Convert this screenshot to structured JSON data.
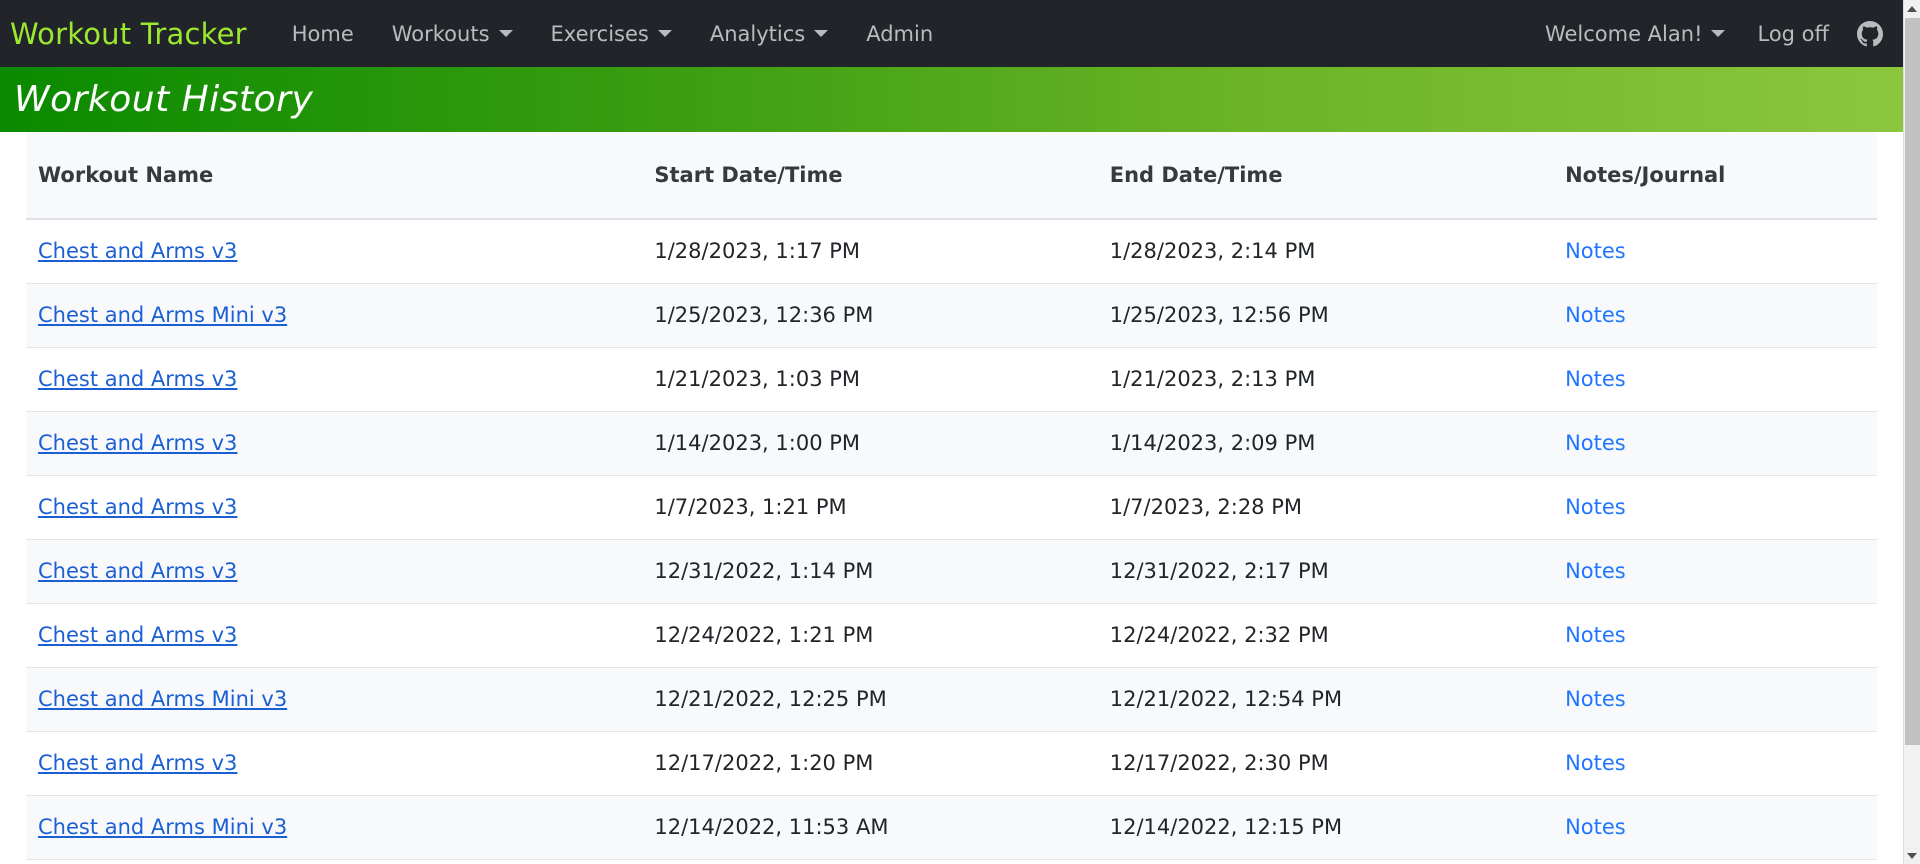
{
  "navbar": {
    "brand": "Workout Tracker",
    "links": [
      {
        "label": "Home",
        "has_caret": false
      },
      {
        "label": "Workouts",
        "has_caret": true
      },
      {
        "label": "Exercises",
        "has_caret": true
      },
      {
        "label": "Analytics",
        "has_caret": true
      },
      {
        "label": "Admin",
        "has_caret": false
      }
    ],
    "welcome_label": "Welcome Alan!",
    "logoff_label": "Log off",
    "github_icon": "github-icon",
    "background_color": "#212529",
    "brand_color": "#9CE82E",
    "link_color": "#B9BCBF"
  },
  "page_header": {
    "title": "Workout History",
    "gradient_from": "#0a8a00",
    "gradient_to": "#8cc63f"
  },
  "table": {
    "columns": [
      "Workout Name",
      "Start Date/Time",
      "End Date/Time",
      "Notes/Journal"
    ],
    "notes_label": "Notes",
    "link_color": "#1a5fd6",
    "notes_link_color": "#2176ff",
    "rows": [
      {
        "name": "Chest and Arms v3",
        "start": "1/28/2023, 1:17 PM",
        "end": "1/28/2023, 2:14 PM",
        "notes": "Notes"
      },
      {
        "name": "Chest and Arms Mini v3",
        "start": "1/25/2023, 12:36 PM",
        "end": "1/25/2023, 12:56 PM",
        "notes": "Notes"
      },
      {
        "name": "Chest and Arms v3",
        "start": "1/21/2023, 1:03 PM",
        "end": "1/21/2023, 2:13 PM",
        "notes": "Notes"
      },
      {
        "name": "Chest and Arms v3",
        "start": "1/14/2023, 1:00 PM",
        "end": "1/14/2023, 2:09 PM",
        "notes": "Notes"
      },
      {
        "name": "Chest and Arms v3",
        "start": "1/7/2023, 1:21 PM",
        "end": "1/7/2023, 2:28 PM",
        "notes": "Notes"
      },
      {
        "name": "Chest and Arms v3",
        "start": "12/31/2022, 1:14 PM",
        "end": "12/31/2022, 2:17 PM",
        "notes": "Notes"
      },
      {
        "name": "Chest and Arms v3",
        "start": "12/24/2022, 1:21 PM",
        "end": "12/24/2022, 2:32 PM",
        "notes": "Notes"
      },
      {
        "name": "Chest and Arms Mini v3",
        "start": "12/21/2022, 12:25 PM",
        "end": "12/21/2022, 12:54 PM",
        "notes": "Notes"
      },
      {
        "name": "Chest and Arms v3",
        "start": "12/17/2022, 1:20 PM",
        "end": "12/17/2022, 2:30 PM",
        "notes": "Notes"
      },
      {
        "name": "Chest and Arms Mini v3",
        "start": "12/14/2022, 11:53 AM",
        "end": "12/14/2022, 12:15 PM",
        "notes": "Notes"
      }
    ]
  },
  "scrollbar": {
    "up_icon": "scroll-up-arrow-icon",
    "down_icon": "scroll-down-arrow-icon",
    "track_color": "#f1f1f1",
    "thumb_color": "#c1c1c1"
  }
}
